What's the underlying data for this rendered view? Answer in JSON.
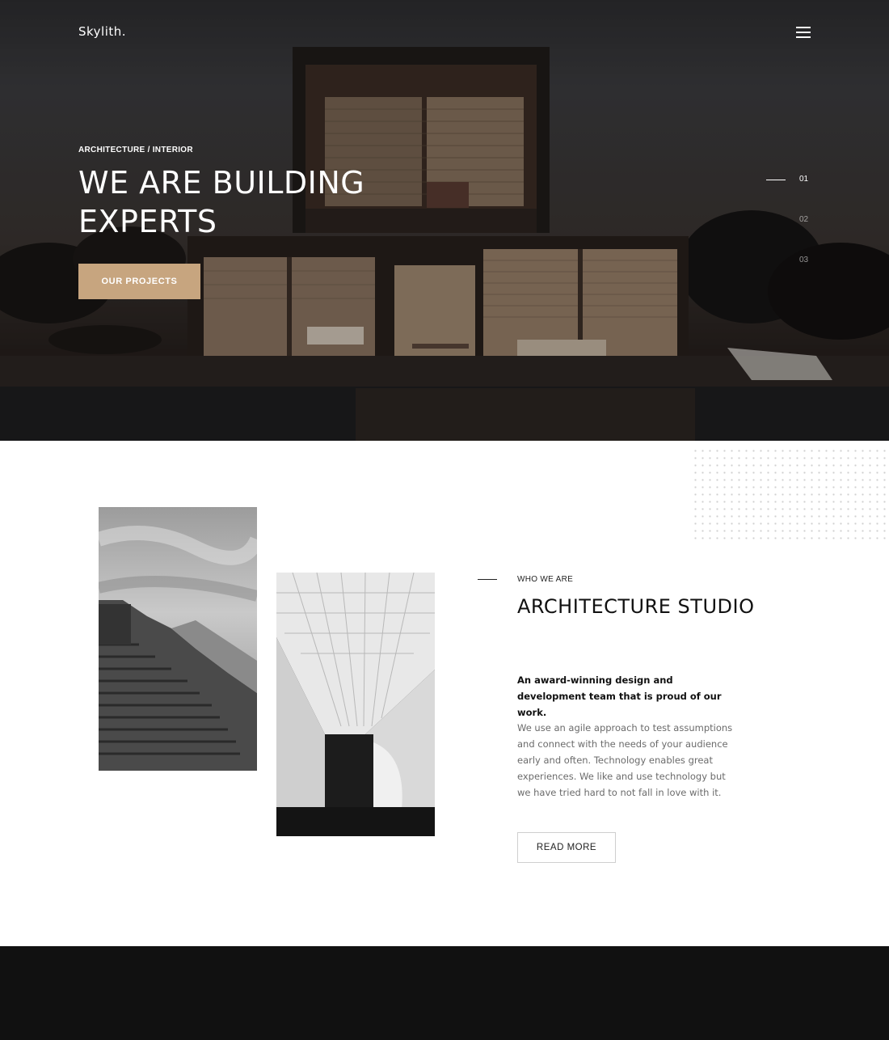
{
  "brand": {
    "logo": "Skylith."
  },
  "hero": {
    "eyebrow": "ARCHITECTURE / INTERIOR",
    "title": "WE ARE BUILDING EXPERTS",
    "cta_label": "OUR PROJECTS",
    "slides": [
      "01",
      "02",
      "03"
    ],
    "active_slide": "01"
  },
  "about": {
    "label": "WHO WE ARE",
    "title": "ARCHITECTURE STUDIO",
    "lead": "An award-winning design and development team that is proud of our work.",
    "body": "We use an agile approach to test assumptions and connect with the needs of your audience early and often. Technology enables great experiences. We like and use technology but we have tried hard to not fall in love with it.",
    "button_label": "READ MORE"
  },
  "colors": {
    "accent": "#c7a57f",
    "footer": "#111111"
  },
  "icons": {
    "menu": "hamburger-menu-icon"
  }
}
